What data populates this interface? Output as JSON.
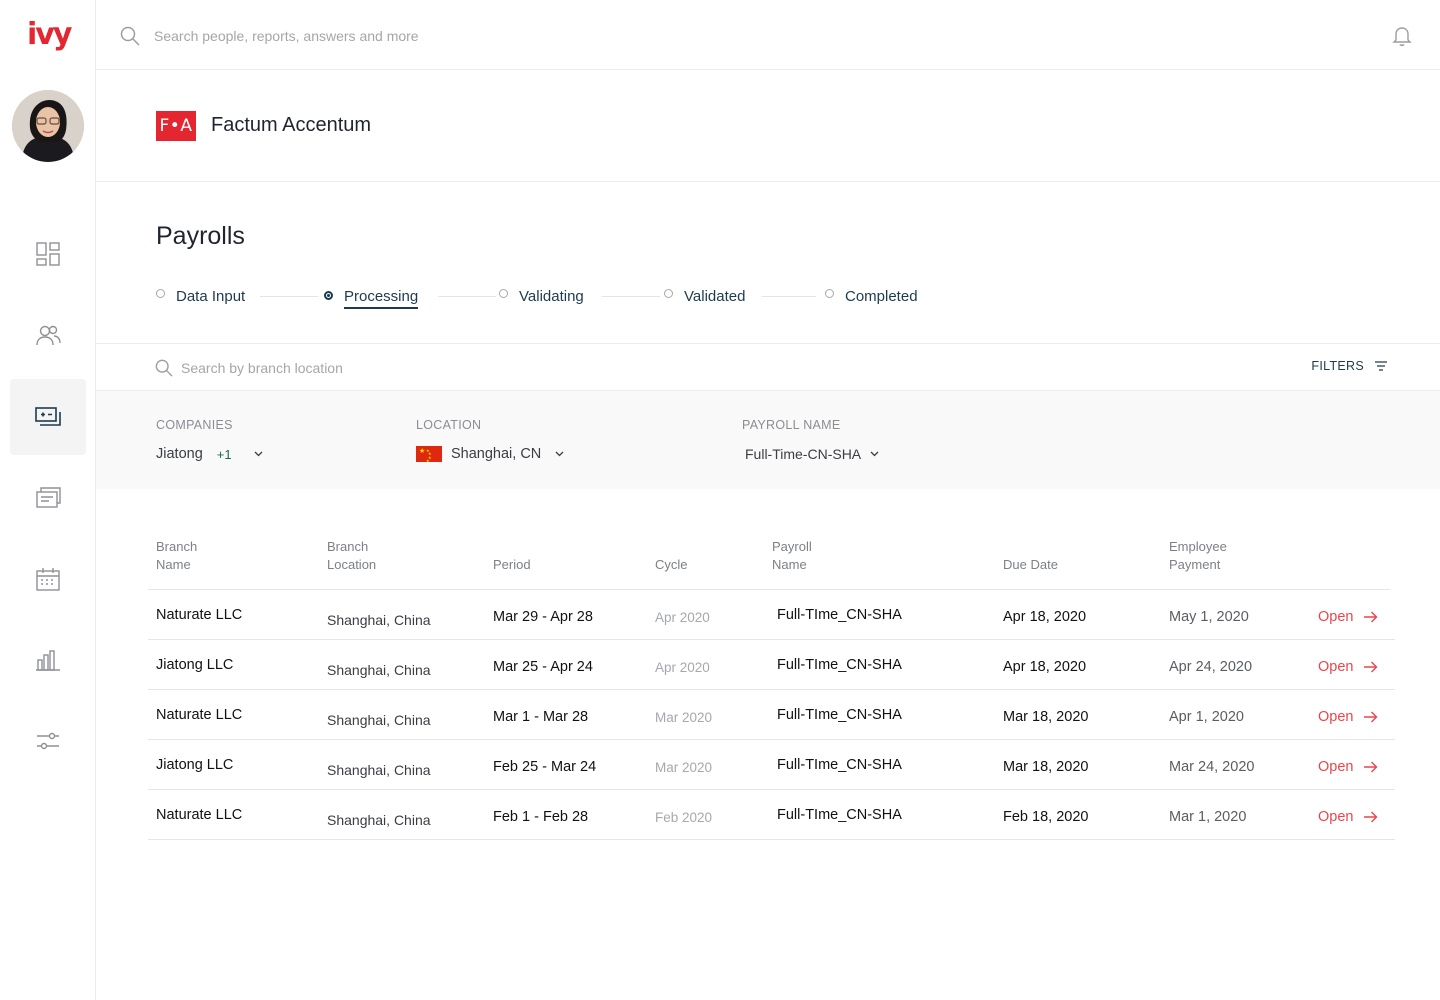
{
  "brand": {
    "logo_text": "ivy",
    "accent": "#e3262f"
  },
  "topbar": {
    "search_placeholder": "Search people, reports, answers and more"
  },
  "sidebar": {
    "items": [
      {
        "name": "dashboard-icon",
        "active": false
      },
      {
        "name": "people-icon",
        "active": false
      },
      {
        "name": "payroll-icon",
        "active": true
      },
      {
        "name": "documents-icon",
        "active": false
      },
      {
        "name": "calendar-icon",
        "active": false
      },
      {
        "name": "reports-icon",
        "active": false
      },
      {
        "name": "settings-sliders-icon",
        "active": false
      }
    ]
  },
  "company": {
    "logo": "F•A",
    "name": "Factum Accentum"
  },
  "page": {
    "title": "Payrolls"
  },
  "steps": [
    {
      "label": "Data Input",
      "active": false
    },
    {
      "label": "Processing",
      "active": true
    },
    {
      "label": "Validating",
      "active": false
    },
    {
      "label": "Validated",
      "active": false
    },
    {
      "label": "Completed",
      "active": false
    }
  ],
  "search": {
    "placeholder": "Search by branch location",
    "filters_label": "FILTERS"
  },
  "filters": {
    "companies": {
      "label": "COMPANIES",
      "value": "Jiatong",
      "extra": "+1"
    },
    "location": {
      "label": "LOCATION",
      "value": "Shanghai, CN"
    },
    "payroll_name": {
      "label": "PAYROLL NAME",
      "value": "Full-Time-CN-SHA"
    }
  },
  "table": {
    "headers": {
      "branch_name": [
        "Branch",
        "Name"
      ],
      "branch_location": [
        "Branch",
        "Location"
      ],
      "period": "Period",
      "cycle": "Cycle",
      "payroll_name": [
        "Payroll",
        "Name"
      ],
      "due_date": "Due Date",
      "employee_payment": [
        "Employee",
        "Payment"
      ]
    },
    "rows": [
      {
        "name": "Naturate LLC",
        "location": "Shanghai, China",
        "period": "Mar 29 - Apr 28",
        "cycle": "Apr 2020",
        "payroll": "Full-TIme_CN-SHA",
        "due": "Apr 18, 2020",
        "payment": "May 1, 2020",
        "action": "Open"
      },
      {
        "name": "Jiatong LLC",
        "location": "Shanghai, China",
        "period": "Mar 25  - Apr 24",
        "cycle": "Apr 2020",
        "payroll": "Full-TIme_CN-SHA",
        "due": "Apr 18, 2020",
        "payment": "Apr 24, 2020",
        "action": "Open"
      },
      {
        "name": "Naturate LLC",
        "location": "Shanghai, China",
        "period": "Mar 1 - Mar 28",
        "cycle": "Mar 2020",
        "payroll": "Full-TIme_CN-SHA",
        "due": "Mar 18, 2020",
        "payment": "Apr 1, 2020",
        "action": "Open"
      },
      {
        "name": "Jiatong LLC",
        "location": "Shanghai, China",
        "period": "Feb 25  - Mar 24",
        "cycle": "Mar 2020",
        "payroll": "Full-TIme_CN-SHA",
        "due": "Mar 18, 2020",
        "payment": "Mar 24, 2020",
        "action": "Open"
      },
      {
        "name": "Naturate LLC",
        "location": "Shanghai, China",
        "period": "Feb 1 - Feb 28",
        "cycle": "Feb 2020",
        "payroll": "Full-TIme_CN-SHA",
        "due": "Feb 18, 2020",
        "payment": "Mar 1, 2020",
        "action": "Open"
      }
    ]
  }
}
